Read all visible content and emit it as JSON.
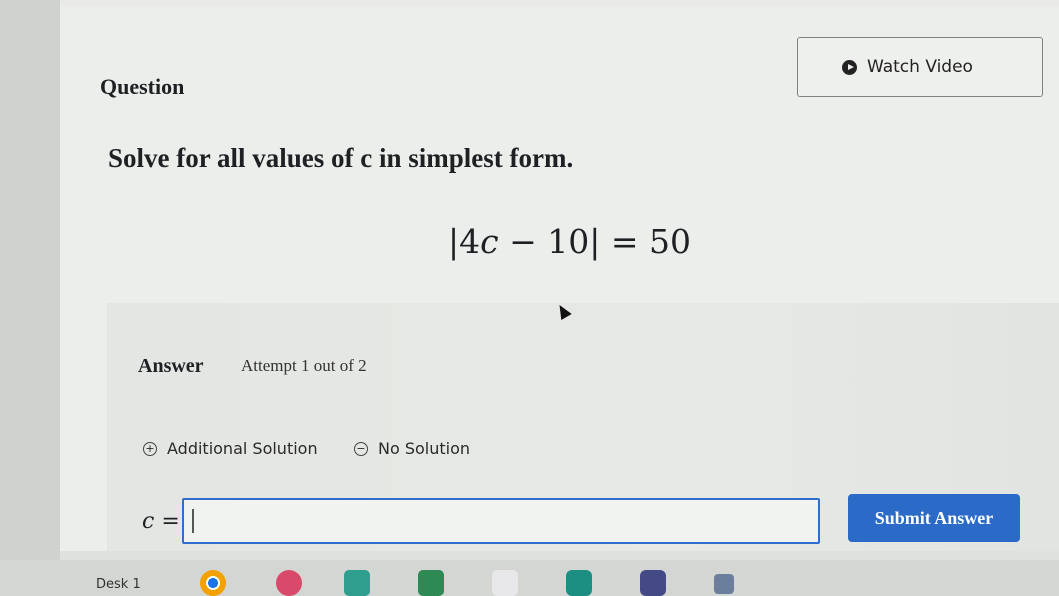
{
  "question": {
    "label": "Question",
    "watch_video_label": "Watch Video",
    "prompt": "Solve for all values of c in simplest form.",
    "equation": {
      "open_bar": "|",
      "coef": "4",
      "var": "c",
      "rest": " − 10",
      "close_bar": "|",
      "rhs": " = 50"
    }
  },
  "answer": {
    "label": "Answer",
    "attempt": "Attempt 1 out of 2",
    "options": {
      "additional": "Additional Solution",
      "none": "No Solution"
    },
    "input_prefix_var": "c",
    "input_prefix_eq": " =",
    "input_value": "",
    "submit_label": "Submit Answer"
  },
  "taskbar": {
    "desk_label": "Desk 1"
  },
  "colors": {
    "accent": "#2c6ac7",
    "input_border": "#2f6fc9"
  },
  "icons": [
    "play-circle-icon",
    "plus-circle-icon",
    "minus-circle-icon",
    "mouse-pointer-icon"
  ]
}
